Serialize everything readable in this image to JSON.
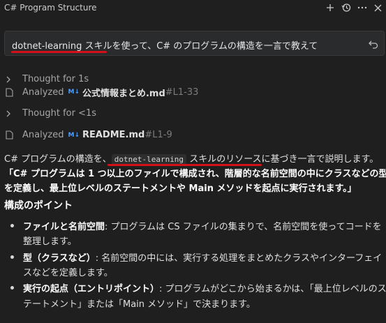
{
  "window": {
    "title": "C# Program Structure",
    "icons": [
      "plus-icon",
      "history-icon",
      "more-icon",
      "close-icon"
    ]
  },
  "prompt": {
    "text": "dotnet-learning スキルを使って、C# のプログラムの構造を一言で教えて"
  },
  "activity": [
    {
      "kind": "thought",
      "label": "Thought for 1s"
    },
    {
      "kind": "analyzed",
      "label": "Analyzed",
      "badge": "M↓",
      "file": "公式情報まとめ.md",
      "loc": "#L1-33"
    },
    {
      "kind": "thought",
      "label": "Thought for <1s"
    },
    {
      "kind": "analyzed",
      "label": "Analyzed",
      "badge": "M↓",
      "file": "README.md",
      "loc": "#L1-9"
    }
  ],
  "answer": {
    "intro_pre": "C# プログラムの構造を、",
    "intro_code": "dotnet-learning",
    "intro_post": "スキルのリソースに基づき一言で説明します。",
    "quote_line1": "「C# プログラムは 1 つ以上のファイルで構成され、階層的な名前空間の中にクラスなどの型",
    "quote_line2": "を定義し、最上位レベルのステートメントや Main メソッドを起点に実行されます。」",
    "heading": "構成のポイント",
    "bullets": [
      {
        "term": "ファイルと名前空間",
        "sep": ": ",
        "line1": "プログラムは CS ファイルの集まりで、名前空間を使ってコードを",
        "line2": "整理します。"
      },
      {
        "term": "型（クラスなど）",
        "sep": ": ",
        "line1": "名前空間の中には、実行する処理をまとめたクラスやインターフェイ",
        "line2": "スなどを定義します。"
      },
      {
        "term": "実行の起点（エントリポイント）",
        "sep": ": ",
        "line1": "プログラムがどこから始まるかは、「最上位レベルのス",
        "line2": "テートメント」または「Main メソッド」で決まります。"
      }
    ]
  },
  "colors": {
    "background": "#1f1f1f",
    "annotation_red": "#d4101a",
    "badge_blue": "#4a9eff"
  }
}
